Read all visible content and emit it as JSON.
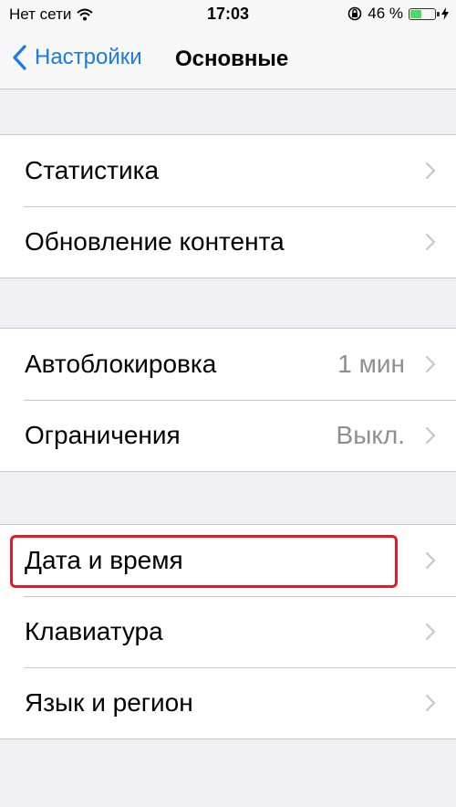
{
  "status_bar": {
    "carrier": "Нет сети",
    "time": "17:03",
    "battery_percent": "46 %",
    "battery_level": 0.46,
    "icons": [
      "wifi-icon",
      "orientation-lock-icon",
      "battery-icon",
      "charging-bolt-icon"
    ]
  },
  "nav": {
    "back_label": "Настройки",
    "title": "Основные"
  },
  "groups": [
    {
      "rows": [
        {
          "label": "Статистика",
          "value": ""
        },
        {
          "label": "Обновление контента",
          "value": ""
        }
      ]
    },
    {
      "rows": [
        {
          "label": "Автоблокировка",
          "value": "1 мин"
        },
        {
          "label": "Ограничения",
          "value": "Выкл."
        }
      ]
    },
    {
      "rows": [
        {
          "label": "Дата и время",
          "value": ""
        },
        {
          "label": "Клавиатура",
          "value": ""
        },
        {
          "label": "Язык и регион",
          "value": ""
        }
      ]
    }
  ],
  "colors": {
    "accent": "#1a7ae6",
    "highlight": "#e31b23",
    "background": "#efeff4",
    "battery": "#4cd964"
  }
}
